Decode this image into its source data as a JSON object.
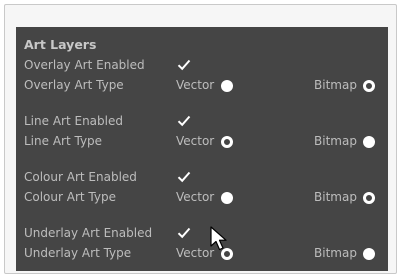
{
  "panel": {
    "title": "Art Layers",
    "layers": [
      {
        "enabled_label": "Overlay Art Enabled",
        "enabled": true,
        "type_label": "Overlay Art Type",
        "vector_label": "Vector",
        "bitmap_label": "Bitmap",
        "selected": "Bitmap"
      },
      {
        "enabled_label": "Line Art Enabled",
        "enabled": true,
        "type_label": "Line Art Type",
        "vector_label": "Vector",
        "bitmap_label": "Bitmap",
        "selected": "Vector"
      },
      {
        "enabled_label": "Colour Art Enabled",
        "enabled": true,
        "type_label": "Colour Art Type",
        "vector_label": "Vector",
        "bitmap_label": "Bitmap",
        "selected": "Bitmap"
      },
      {
        "enabled_label": "Underlay Art Enabled",
        "enabled": true,
        "type_label": "Underlay Art Type",
        "vector_label": "Vector",
        "bitmap_label": "Bitmap",
        "selected": "Vector"
      }
    ]
  },
  "colors": {
    "panel_bg": "#454545",
    "text": "#bdbdbd",
    "radio": "#ffffff"
  },
  "cursor_icon": "arrow-pointer-icon"
}
